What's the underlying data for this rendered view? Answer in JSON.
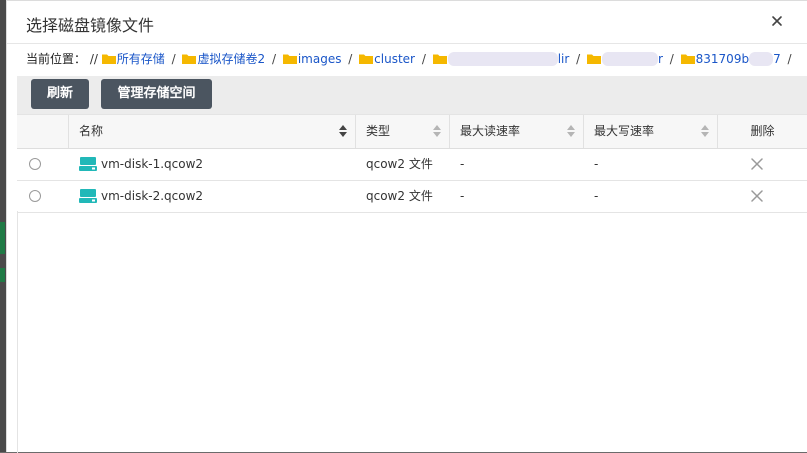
{
  "dialog": {
    "title": "选择磁盘镜像文件"
  },
  "breadcrumb": {
    "prefix": "当前位置：",
    "root": "//",
    "items": [
      {
        "label": "所有存储"
      },
      {
        "label": "虚拟存储卷2"
      },
      {
        "label": "images"
      },
      {
        "label": "cluster"
      },
      {
        "label": "lir"
      },
      {
        "label": "r"
      },
      {
        "label": "831709b"
      },
      {
        "label": "7"
      }
    ],
    "separator": "/"
  },
  "toolbar": {
    "refresh_label": "刷新",
    "manage_label": "管理存储空间"
  },
  "table": {
    "columns": {
      "name": "名称",
      "type": "类型",
      "max_read": "最大读速率",
      "max_write": "最大写速率",
      "delete": "删除"
    },
    "rows": [
      {
        "name": "vm-disk-1.qcow2",
        "type": "qcow2 文件",
        "max_read": "-",
        "max_write": "-"
      },
      {
        "name": "vm-disk-2.qcow2",
        "type": "qcow2 文件",
        "max_read": "-",
        "max_write": "-"
      }
    ]
  },
  "colors": {
    "accent_button": "#4b5560",
    "link": "#1a56c8",
    "folder": "#f5b800",
    "disk_icon": "#21b8b8"
  }
}
